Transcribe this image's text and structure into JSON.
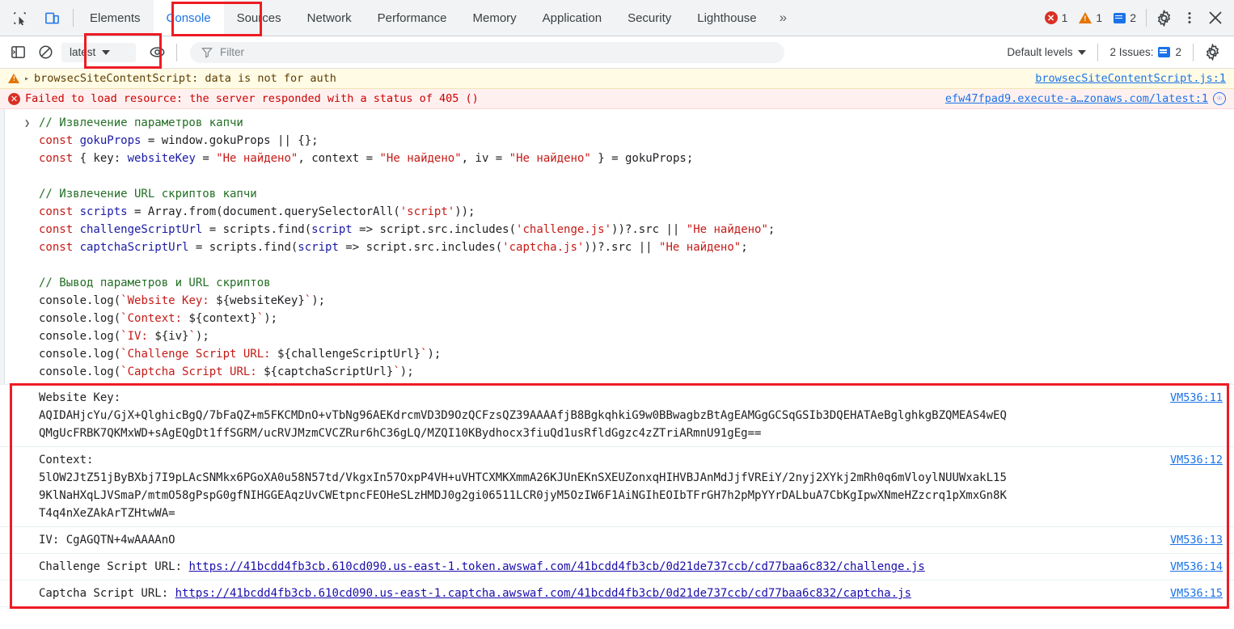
{
  "toolbar": {
    "inspect_icon": "inspect-element-icon",
    "device_icon": "device-toolbar-icon",
    "tabs": [
      {
        "label": "Elements",
        "selected": false
      },
      {
        "label": "Console",
        "selected": true
      },
      {
        "label": "Sources",
        "selected": false
      },
      {
        "label": "Network",
        "selected": false
      },
      {
        "label": "Performance",
        "selected": false
      },
      {
        "label": "Memory",
        "selected": false
      },
      {
        "label": "Application",
        "selected": false
      },
      {
        "label": "Security",
        "selected": false
      },
      {
        "label": "Lighthouse",
        "selected": false
      }
    ],
    "more_tabs": "»",
    "error_count": "1",
    "warning_count": "1",
    "message_count": "2",
    "settings_icon": "gear-icon",
    "more_icon": "kebab-menu-icon",
    "close_icon": "close-icon",
    "accent_color": "#1a73e8",
    "error_color": "#d93025",
    "warning_color": "#e37400"
  },
  "filterbar": {
    "sidebar_toggle_icon": "console-sidebar-icon",
    "clear_icon": "clear-console-icon",
    "context_selector": "latest",
    "eye_icon": "live-expression-icon",
    "filter_icon": "filter-icon",
    "filter_placeholder": "Filter",
    "filter_value": "",
    "levels_label": "Default levels",
    "issues_label": "2 Issues:",
    "issues_count": "2",
    "settings_icon": "settings-gear-icon"
  },
  "messages": [
    {
      "type": "warning",
      "expand_arrow": "▸",
      "text": "browsecSiteContentScript: data is not for auth",
      "source": "browsecSiteContentScript.js:1",
      "has_globe": false
    },
    {
      "type": "error",
      "text": "Failed to load resource: the server responded with a status of 405 ()",
      "source": "efw47fpad9.execute-a…zonaws.com/latest:1",
      "has_globe": true
    }
  ],
  "code": {
    "lines": [
      [
        {
          "t": "// Извлечение параметров капчи",
          "c": "c-com"
        }
      ],
      [
        {
          "t": "const ",
          "c": "c-kw"
        },
        {
          "t": "gokuProps",
          "c": "c-var"
        },
        {
          "t": " = window.gokuProps || {};",
          "c": "c-plain"
        }
      ],
      [
        {
          "t": "const ",
          "c": "c-kw"
        },
        {
          "t": "{ key: ",
          "c": "c-plain"
        },
        {
          "t": "websiteKey",
          "c": "c-var"
        },
        {
          "t": " = ",
          "c": "c-plain"
        },
        {
          "t": "\"Не найдено\"",
          "c": "c-str"
        },
        {
          "t": ", context = ",
          "c": "c-plain"
        },
        {
          "t": "\"Не найдено\"",
          "c": "c-str"
        },
        {
          "t": ", iv = ",
          "c": "c-plain"
        },
        {
          "t": "\"Не найдено\"",
          "c": "c-str"
        },
        {
          "t": " } = gokuProps;",
          "c": "c-plain"
        }
      ],
      [
        {
          "t": "",
          "c": "c-plain"
        }
      ],
      [
        {
          "t": "// Извлечение URL скриптов капчи",
          "c": "c-com"
        }
      ],
      [
        {
          "t": "const ",
          "c": "c-kw"
        },
        {
          "t": "scripts",
          "c": "c-var"
        },
        {
          "t": " = Array.from(document.querySelectorAll(",
          "c": "c-plain"
        },
        {
          "t": "'script'",
          "c": "c-str"
        },
        {
          "t": "));",
          "c": "c-plain"
        }
      ],
      [
        {
          "t": "const ",
          "c": "c-kw"
        },
        {
          "t": "challengeScriptUrl",
          "c": "c-var"
        },
        {
          "t": " = scripts.find(",
          "c": "c-plain"
        },
        {
          "t": "script",
          "c": "c-var"
        },
        {
          "t": " => script.src.includes(",
          "c": "c-plain"
        },
        {
          "t": "'challenge.js'",
          "c": "c-str"
        },
        {
          "t": "))?.src || ",
          "c": "c-plain"
        },
        {
          "t": "\"Не найдено\"",
          "c": "c-str"
        },
        {
          "t": ";",
          "c": "c-plain"
        }
      ],
      [
        {
          "t": "const ",
          "c": "c-kw"
        },
        {
          "t": "captchaScriptUrl",
          "c": "c-var"
        },
        {
          "t": " = scripts.find(",
          "c": "c-plain"
        },
        {
          "t": "script",
          "c": "c-var"
        },
        {
          "t": " => script.src.includes(",
          "c": "c-plain"
        },
        {
          "t": "'captcha.js'",
          "c": "c-str"
        },
        {
          "t": "))?.src || ",
          "c": "c-plain"
        },
        {
          "t": "\"Не найдено\"",
          "c": "c-str"
        },
        {
          "t": ";",
          "c": "c-plain"
        }
      ],
      [
        {
          "t": "",
          "c": "c-plain"
        }
      ],
      [
        {
          "t": "// Вывод параметров и URL скриптов",
          "c": "c-com"
        }
      ],
      [
        {
          "t": "console.log(",
          "c": "c-plain"
        },
        {
          "t": "`Website Key: ",
          "c": "c-str"
        },
        {
          "t": "${websiteKey}",
          "c": "c-plain"
        },
        {
          "t": "`",
          "c": "c-str"
        },
        {
          "t": ");",
          "c": "c-plain"
        }
      ],
      [
        {
          "t": "console.log(",
          "c": "c-plain"
        },
        {
          "t": "`Context: ",
          "c": "c-str"
        },
        {
          "t": "${context}",
          "c": "c-plain"
        },
        {
          "t": "`",
          "c": "c-str"
        },
        {
          "t": ");",
          "c": "c-plain"
        }
      ],
      [
        {
          "t": "console.log(",
          "c": "c-plain"
        },
        {
          "t": "`IV: ",
          "c": "c-str"
        },
        {
          "t": "${iv}",
          "c": "c-plain"
        },
        {
          "t": "`",
          "c": "c-str"
        },
        {
          "t": ");",
          "c": "c-plain"
        }
      ],
      [
        {
          "t": "console.log(",
          "c": "c-plain"
        },
        {
          "t": "`Challenge Script URL: ",
          "c": "c-str"
        },
        {
          "t": "${challengeScriptUrl}",
          "c": "c-plain"
        },
        {
          "t": "`",
          "c": "c-str"
        },
        {
          "t": ");",
          "c": "c-plain"
        }
      ],
      [
        {
          "t": "console.log(",
          "c": "c-plain"
        },
        {
          "t": "`Captcha Script URL: ",
          "c": "c-str"
        },
        {
          "t": "${captchaScriptUrl}",
          "c": "c-plain"
        },
        {
          "t": "`",
          "c": "c-str"
        },
        {
          "t": ");",
          "c": "c-plain"
        }
      ]
    ]
  },
  "output": [
    {
      "text": "Website Key:\nAQIDAHjcYu/GjX+QlghicBgQ/7bFaQZ+m5FKCMDnO+vTbNg96AEKdrcmVD3D9OzQCFzsQZ39AAAAfjB8BgkqhkiG9w0BBwagbzBtAgEAMGgGCSqGSIb3DQEHATAeBglghkgBZQMEAS4wEQQMgUcFRBK7QKMxWD+sAgEQgDt1ffSGRM/ucRVJMzmCVCZRur6hC36gLQ/MZQI10KBydhocx3fiuQd1usRfldGgzc4zZTriARmnU91gEg==",
      "source": "VM536:11",
      "is_link": false
    },
    {
      "text": "Context:\n5lOW2JtZ51jByBXbj7I9pLAcSNMkx6PGoXA0u58N57td/VkgxIn57OxpP4VH+uVHTCXMKXmmA26KJUnEKnSXEUZonxqHIHVBJAnMdJjfVREiY/2nyj2XYkj2mRh0q6mVloylNUUWxakL159KlNaHXqLJVSmaP/mtmO58gPspG0gfNIHGGEAqzUvCWEtpncFEOHeSLzHMDJ0g2gi06511LCR0jyM5OzIW6F1AiNGIhEOIbTFrGH7h2pMpYYrDALbuA7CbKgIpwXNmeHZzcrq1pXmxGn8KT4q4nXeZAkArTZHtwWA=",
      "source": "VM536:12",
      "is_link": false
    },
    {
      "text": "IV: CgAGQTN+4wAAAAnO",
      "source": "VM536:13",
      "is_link": false
    },
    {
      "text": "Challenge Script URL: ",
      "url": "https://41bcdd4fb3cb.610cd090.us-east-1.token.awswaf.com/41bcdd4fb3cb/0d21de737ccb/cd77baa6c832/challenge.js",
      "source": "VM536:14",
      "is_link": true
    },
    {
      "text": "Captcha Script URL: ",
      "url": "https://41bcdd4fb3cb.610cd090.us-east-1.captcha.awswaf.com/41bcdd4fb3cb/0d21de737ccb/cd77baa6c832/captcha.js",
      "source": "VM536:15",
      "is_link": true
    }
  ],
  "annotations": {
    "color": "#ed1c24",
    "boxes": [
      "console-tab-highlight",
      "context-selector-highlight",
      "output-block-highlight"
    ]
  }
}
